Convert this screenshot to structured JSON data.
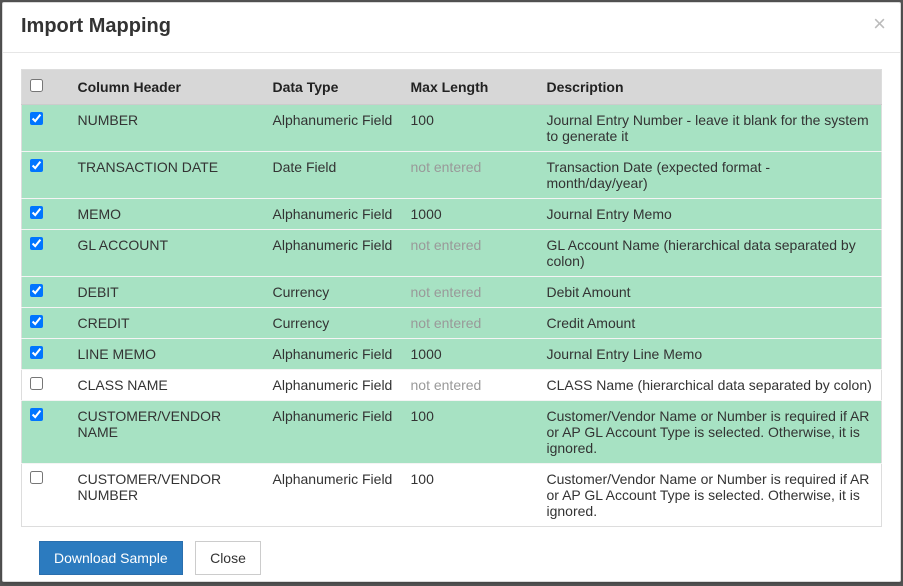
{
  "modal": {
    "title": "Import Mapping",
    "close_label": "×"
  },
  "table": {
    "headers": {
      "column_header": "Column Header",
      "data_type": "Data Type",
      "max_length": "Max Length",
      "description": "Description"
    },
    "rows": [
      {
        "checked": true,
        "column_header": "NUMBER",
        "data_type": "Alphanumeric Field",
        "max_length": "100",
        "max_entered": true,
        "description": "Journal Entry Number - leave it blank for the system to generate it"
      },
      {
        "checked": true,
        "column_header": "TRANSACTION DATE",
        "data_type": "Date Field",
        "max_length": "not entered",
        "max_entered": false,
        "description": "Transaction Date (expected format - month/day/year)"
      },
      {
        "checked": true,
        "column_header": "MEMO",
        "data_type": "Alphanumeric Field",
        "max_length": "1000",
        "max_entered": true,
        "description": "Journal Entry Memo"
      },
      {
        "checked": true,
        "column_header": "GL ACCOUNT",
        "data_type": "Alphanumeric Field",
        "max_length": "not entered",
        "max_entered": false,
        "description": "GL Account Name (hierarchical data separated by colon)"
      },
      {
        "checked": true,
        "column_header": "DEBIT",
        "data_type": "Currency",
        "max_length": "not entered",
        "max_entered": false,
        "description": "Debit Amount"
      },
      {
        "checked": true,
        "column_header": "CREDIT",
        "data_type": "Currency",
        "max_length": "not entered",
        "max_entered": false,
        "description": "Credit Amount"
      },
      {
        "checked": true,
        "column_header": "LINE MEMO",
        "data_type": "Alphanumeric Field",
        "max_length": "1000",
        "max_entered": true,
        "description": "Journal Entry Line Memo"
      },
      {
        "checked": false,
        "column_header": "CLASS NAME",
        "data_type": "Alphanumeric Field",
        "max_length": "not entered",
        "max_entered": false,
        "description": "CLASS Name (hierarchical data separated by colon)"
      },
      {
        "checked": true,
        "column_header": "CUSTOMER/VENDOR NAME",
        "data_type": "Alphanumeric Field",
        "max_length": "100",
        "max_entered": true,
        "description": "Customer/Vendor Name or Number is required if AR or AP GL Account Type is selected. Otherwise, it is ignored."
      },
      {
        "checked": false,
        "column_header": "CUSTOMER/VENDOR NUMBER",
        "data_type": "Alphanumeric Field",
        "max_length": "100",
        "max_entered": true,
        "description": "Customer/Vendor Name or Number is required if AR or AP GL Account Type is selected. Otherwise, it is ignored."
      }
    ]
  },
  "footer": {
    "download_sample": "Download Sample",
    "close": "Close"
  }
}
